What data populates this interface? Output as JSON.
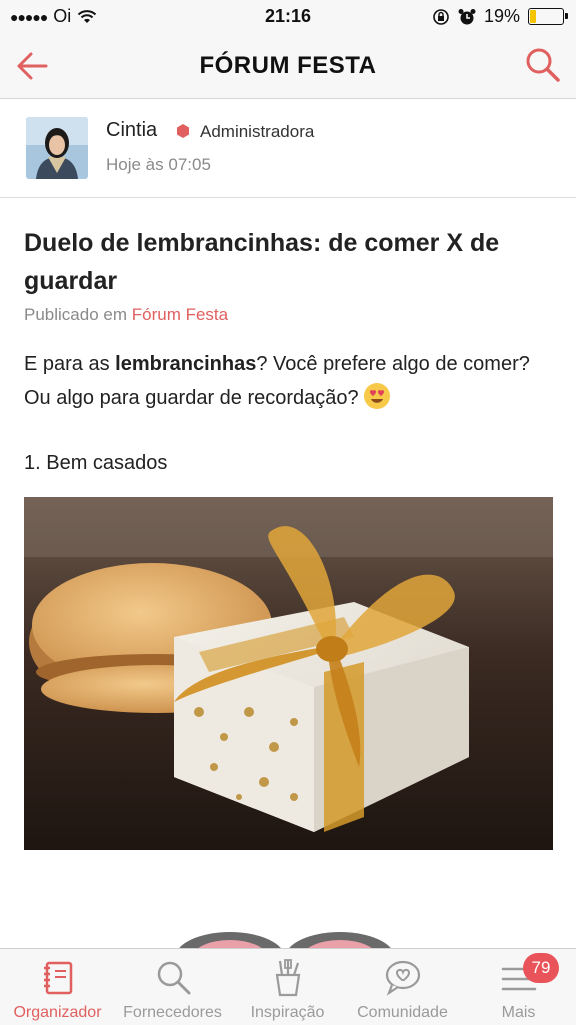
{
  "status_bar": {
    "carrier": "Oi",
    "time": "21:16",
    "battery_percent": "19%",
    "battery_level": 0.19
  },
  "nav": {
    "title": "FÓRUM FESTA",
    "back_icon": "arrow-left-icon",
    "search_icon": "search-icon"
  },
  "author": {
    "name": "Cintia",
    "role": "Administradora",
    "time": "Hoje às 07:05"
  },
  "post": {
    "title": "Duelo de lembrancinhas: de comer X de guardar",
    "published_prefix": "Publicado em",
    "published_forum": "Fórum Festa",
    "body_part1": "E para as ",
    "body_bold": "lembrancinhas",
    "body_part2": "? Você prefere algo de comer? Ou algo para guardar de recordação?",
    "list_item_1": "1. Bem casados"
  },
  "tabbar": {
    "tabs": [
      {
        "label": "Organizador",
        "icon": "notebook-icon",
        "active": true
      },
      {
        "label": "Fornecedores",
        "icon": "search-icon",
        "active": false
      },
      {
        "label": "Inspiração",
        "icon": "pencil-cup-icon",
        "active": false
      },
      {
        "label": "Comunidade",
        "icon": "chat-heart-icon",
        "active": false
      },
      {
        "label": "Mais",
        "icon": "menu-icon",
        "active": false
      }
    ],
    "more_badge": "79"
  },
  "colors": {
    "accent": "#e0605f",
    "badge": "#e9545a"
  }
}
